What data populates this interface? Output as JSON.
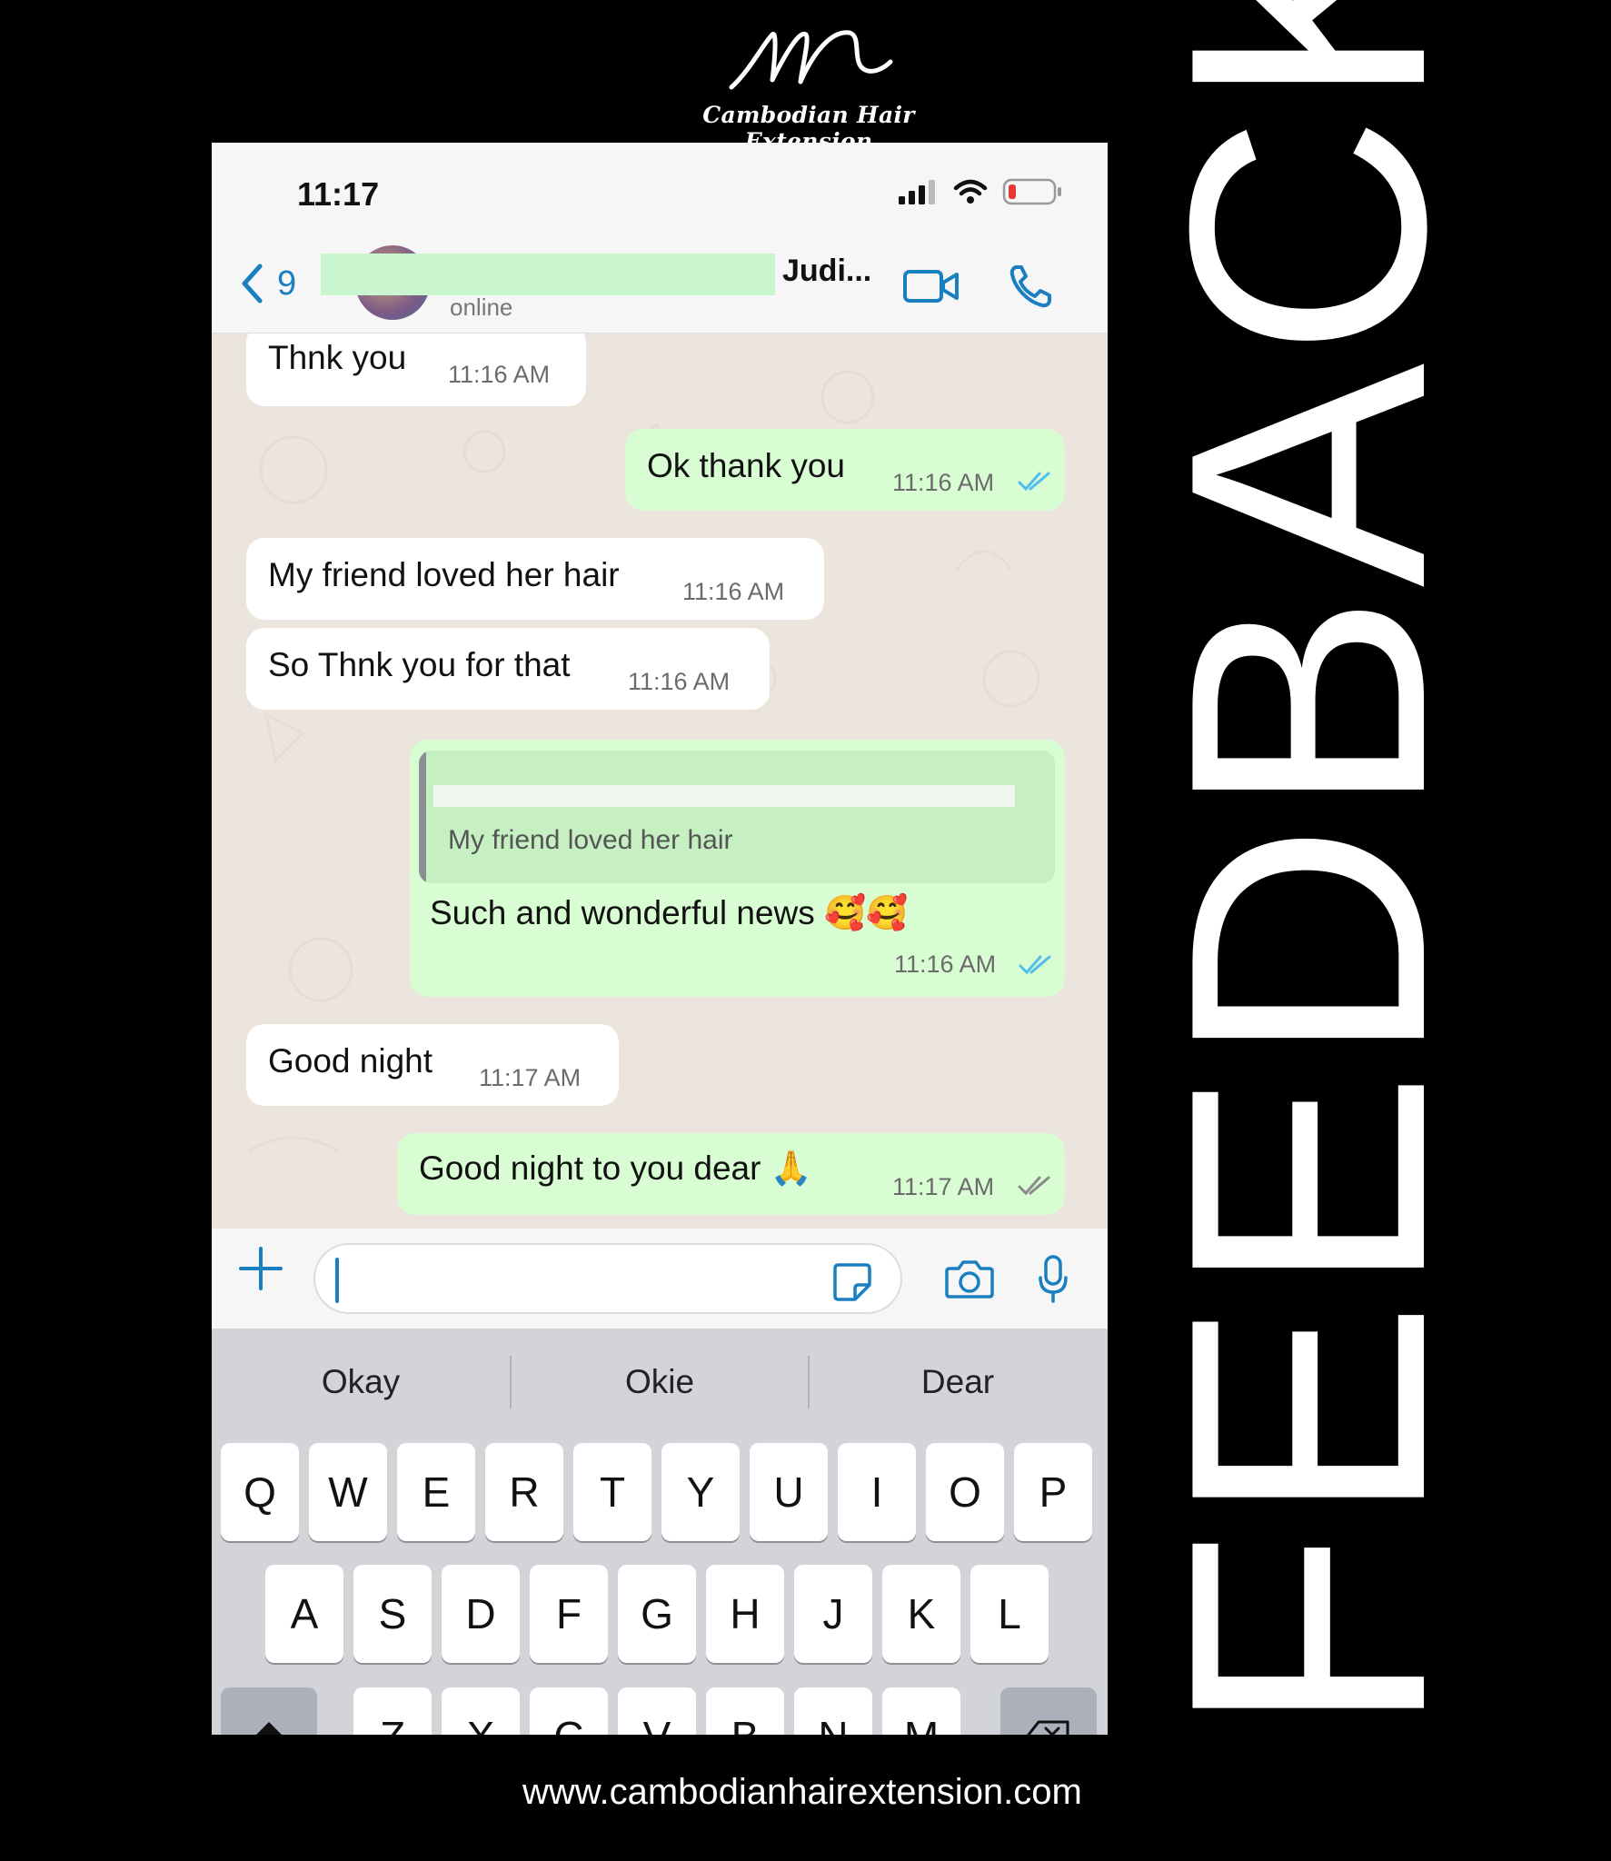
{
  "brand": {
    "name": "Cambodian Hair Extension"
  },
  "headline": "FEEDBACK",
  "website": "www.cambodianhairextension.com",
  "phone": {
    "status_bar": {
      "time": "11:17"
    },
    "header": {
      "back_count": "9",
      "contact_name": "Judi...",
      "contact_status": "online"
    },
    "messages": [
      {
        "dir": "in",
        "text": "Thnk you",
        "time": "11:16 AM"
      },
      {
        "dir": "out",
        "text": "Ok thank you",
        "time": "11:16 AM",
        "ticks": "read"
      },
      {
        "dir": "in",
        "text": "My friend loved her hair",
        "time": "11:16 AM"
      },
      {
        "dir": "in",
        "text": "So Thnk you for that",
        "time": "11:16 AM"
      },
      {
        "dir": "out",
        "quote": "My friend loved her hair",
        "text": "Such and wonderful news 🥰🥰",
        "time": "11:16 AM",
        "ticks": "read"
      },
      {
        "dir": "in",
        "text": "Good night",
        "time": "11:17 AM"
      },
      {
        "dir": "out",
        "text": "Good night to you dear 🙏",
        "time": "11:17 AM",
        "ticks": "delivered"
      }
    ],
    "input": {
      "value": ""
    },
    "keyboard": {
      "suggestions": [
        "Okay",
        "Okie",
        "Dear"
      ],
      "row1": [
        "Q",
        "W",
        "E",
        "R",
        "T",
        "Y",
        "U",
        "I",
        "O",
        "P"
      ],
      "row2": [
        "A",
        "S",
        "D",
        "F",
        "G",
        "H",
        "J",
        "K",
        "L"
      ],
      "row3": [
        "Z",
        "X",
        "C",
        "V",
        "B",
        "N",
        "M"
      ]
    },
    "colors": {
      "accent": "#1a7fc0",
      "outgoing_bubble": "#d9fdd3",
      "incoming_bubble": "#ffffff",
      "read_tick": "#53bdeb"
    }
  }
}
